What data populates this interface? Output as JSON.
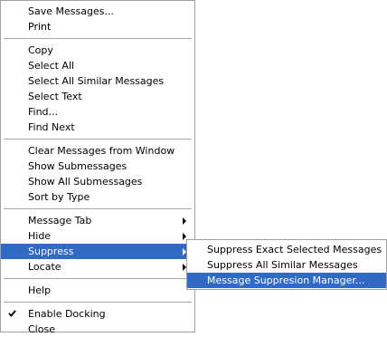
{
  "menu": {
    "groups": [
      [
        "Save Messages...",
        "Print"
      ],
      [
        "Copy",
        "Select All",
        "Select All Similar Messages",
        "Select Text",
        "Find...",
        "Find Next"
      ],
      [
        "Clear Messages from Window",
        "Show Submessages",
        "Show All Submessages",
        "Sort by Type"
      ],
      [
        "Message Tab",
        "Hide",
        "Suppress",
        "Locate"
      ],
      [
        "Help"
      ],
      [
        "Enable Docking",
        "Close"
      ]
    ]
  },
  "submenu": {
    "items": [
      "Suppress Exact Selected Messages",
      "Suppress All Similar Messages",
      "Message Suppresion Manager..."
    ]
  },
  "state": {
    "selected_item": "Suppress",
    "selected_subitem": "Message Suppresion Manager...",
    "checked_items": [
      "Enable Docking"
    ],
    "items_with_submenu": [
      "Message Tab",
      "Hide",
      "Suppress",
      "Locate"
    ]
  },
  "colors": {
    "highlight": "#316ac5",
    "highlight_text": "#ffffff",
    "menu_bg": "#ffffff",
    "border": "#a0a0a0",
    "separator": "#a6a6a6"
  },
  "icons": {
    "submenu_arrow": "arrow-right-icon",
    "checkmark": "checkmark-icon"
  }
}
